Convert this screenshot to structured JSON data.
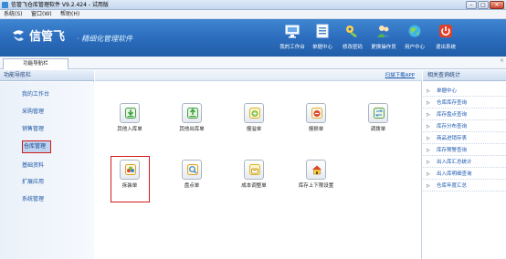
{
  "window": {
    "title": "信管飞仓库管理软件 V9.2.424 - 试用版",
    "controls": [
      "–",
      "□",
      "✕"
    ]
  },
  "menu": [
    "系统(S)",
    "窗口(W)",
    "帮助(H)"
  ],
  "banner": {
    "brand": "信管飞",
    "slogan": "· 精细化管理软件",
    "toolbar": [
      {
        "label": "我的工作台",
        "icon": "monitor-icon"
      },
      {
        "label": "单据中心",
        "icon": "document-list-icon"
      },
      {
        "label": "修改密码",
        "icon": "key-icon"
      },
      {
        "label": "更换操作员",
        "icon": "users-icon"
      },
      {
        "label": "用户中心",
        "icon": "globe-icon"
      },
      {
        "label": "退出系统",
        "icon": "power-icon"
      }
    ]
  },
  "tabs": [
    {
      "label": "功能导航栏"
    }
  ],
  "left_panel": {
    "title": "功能导航栏",
    "items": [
      "我的工作台",
      "采购管理",
      "销售管理",
      "仓库管理",
      "基础资料",
      "扩展应用",
      "系统管理"
    ],
    "active_index": 3
  },
  "center": {
    "scan_link": "扫描下载APP",
    "modules": [
      {
        "label": "其他入库单",
        "icon": "inbound-icon",
        "color": "#3fa03f"
      },
      {
        "label": "其他出库单",
        "icon": "outbound-icon",
        "color": "#3fa03f"
      },
      {
        "label": "报溢单",
        "icon": "overflow-add-icon",
        "color": "#d9b42a"
      },
      {
        "label": "报损单",
        "icon": "loss-minus-icon",
        "color": "#d94a2a"
      },
      {
        "label": "调拨单",
        "icon": "transfer-icon",
        "color": "#5aa03f"
      },
      {
        "label": "拆装单",
        "icon": "assembly-icon",
        "color": "#e0a020"
      },
      {
        "label": "盘点单",
        "icon": "stocktake-icon",
        "color": "#e0a020"
      },
      {
        "label": "成本调整单",
        "icon": "cost-adjust-icon",
        "color": "#d9b42a"
      },
      {
        "label": "库存上下限设置",
        "icon": "warehouse-limit-icon",
        "color": "#d94a2a"
      }
    ],
    "highlighted_module": "拆装单"
  },
  "right_panel": {
    "title": "相关查询统计",
    "items": [
      "单据中心",
      "仓库库存查询",
      "库存盘点查询",
      "库存分布查询",
      "商品进销存表",
      "库存预警查询",
      "出入库汇总统计",
      "出入库明细查询",
      "仓库年度汇总"
    ]
  },
  "colors": {
    "banner": "#2a6bbb",
    "highlight": "#d01b1b",
    "link": "#1756b0"
  }
}
